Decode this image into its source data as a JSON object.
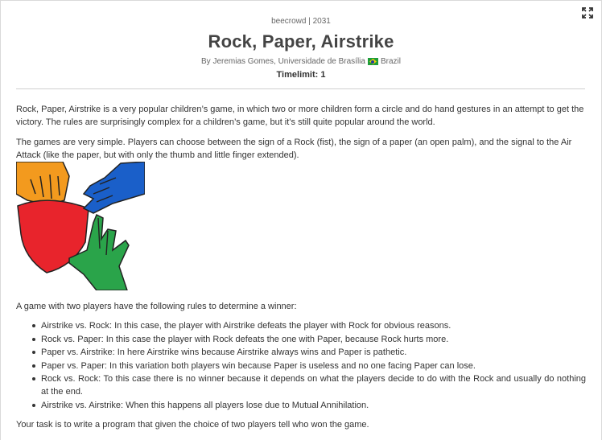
{
  "problem": {
    "source": "beecrowd | 2031",
    "title": "Rock, Paper, Airstrike",
    "author_prefix": "By Jeremias Gomes, Universidade de Brasília",
    "country": "Brazil",
    "timelimit": "Timelimit: 1"
  },
  "description": {
    "paragraph1": "Rock, Paper, Airstrike is a very popular children’s game, in which two or more children form a circle and do hand gestures in an attempt to get the victory. The rules are surprisingly complex for a children’s game, but it’s still quite popular around the world.",
    "paragraph2": "The games are very simple. Players can choose between the sign of a Rock (fist), the sign of a paper (an open palm), and the signal to the Air Attack (like the paper, but with only the thumb and little finger extended).",
    "paragraph3": "A game with two players have the following rules to determine a winner:",
    "rules": [
      "Airstrike vs. Rock: In this case, the player with Airstrike defeats the player with Rock for obvious reasons.",
      "Rock vs. Paper: In this case the player with Rock defeats the one with Paper, because Rock hurts more.",
      "Paper vs. Airstrike: In here Airstrike wins because Airstrike always wins and Paper is pathetic.",
      "Paper vs. Paper: In this variation both players win because Paper is useless and no one facing Paper can lose.",
      "Rock vs. Rock: To this case there is no winner because it depends on what the players decide to do with the Rock and usually do nothing at the end.",
      "Airstrike vs. Airstrike: When this happens all players lose due to Mutual Annihilation."
    ],
    "paragraph4": "Your task is to write a program that given the choice of two players tell who won the game."
  },
  "colors": {
    "fist": "#f39a1e",
    "open_palm": "#1a5fc9",
    "shield": "#e8242c",
    "airstrike_hand": "#2aa44a"
  },
  "icons": [
    "expand-icon",
    "brazil-flag-icon",
    "hand-gestures-illustration"
  ]
}
